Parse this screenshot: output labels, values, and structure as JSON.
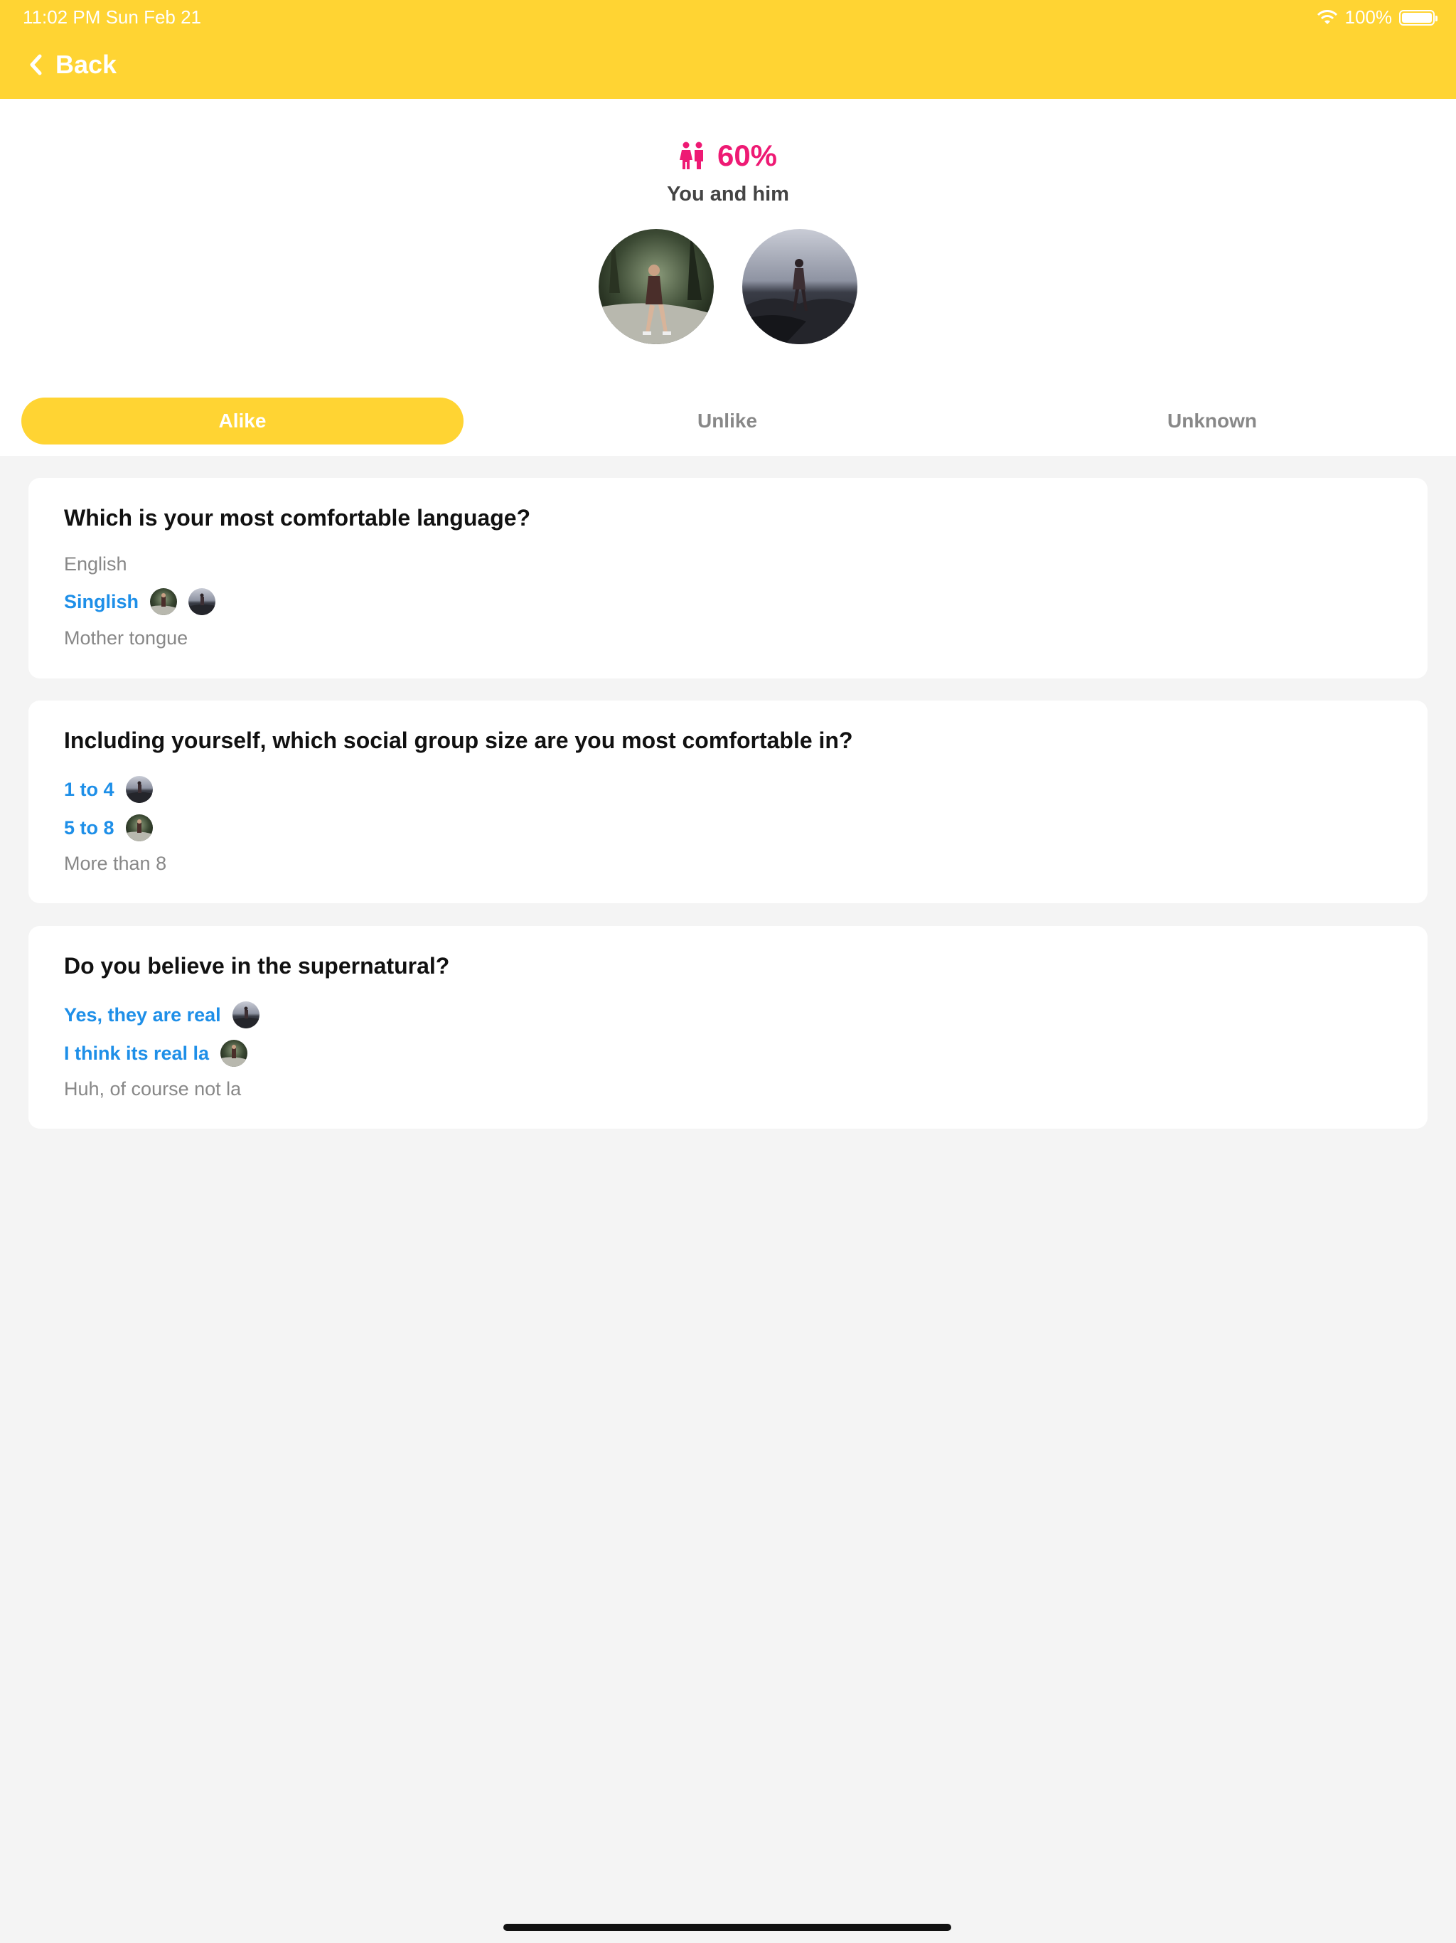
{
  "status": {
    "time": "11:02 PM   Sun Feb 21",
    "battery": "100%"
  },
  "nav": {
    "back_label": "Back"
  },
  "match": {
    "percent": "60%",
    "subtitle": "You and him"
  },
  "tabs": [
    {
      "label": "Alike",
      "active": true
    },
    {
      "label": "Unlike",
      "active": false
    },
    {
      "label": "Unknown",
      "active": false
    }
  ],
  "questions": [
    {
      "question": "Which is your most comfortable language?",
      "options": [
        {
          "label": "English",
          "highlighted": false,
          "avatars": []
        },
        {
          "label": "Singlish",
          "highlighted": true,
          "avatars": [
            "you",
            "him"
          ]
        },
        {
          "label": "Mother tongue",
          "highlighted": false,
          "avatars": []
        }
      ]
    },
    {
      "question": "Including yourself, which social group size are you most comfortable in?",
      "options": [
        {
          "label": "1 to 4",
          "highlighted": true,
          "avatars": [
            "him"
          ]
        },
        {
          "label": "5 to 8",
          "highlighted": true,
          "avatars": [
            "you"
          ]
        },
        {
          "label": "More than 8",
          "highlighted": false,
          "avatars": []
        }
      ]
    },
    {
      "question": "Do you believe in the supernatural?",
      "options": [
        {
          "label": "Yes, they are real",
          "highlighted": true,
          "avatars": [
            "him"
          ]
        },
        {
          "label": "I think its real la",
          "highlighted": true,
          "avatars": [
            "you"
          ]
        },
        {
          "label": "Huh, of course not la",
          "highlighted": false,
          "avatars": []
        }
      ]
    }
  ],
  "colors": {
    "accent": "#ffd433",
    "match_pink": "#ee1a74",
    "highlight_blue": "#1e8fe8"
  },
  "icons": {
    "back": "chevron-left-icon",
    "match": "couple-icon",
    "wifi": "wifi-icon",
    "battery": "battery-icon"
  }
}
